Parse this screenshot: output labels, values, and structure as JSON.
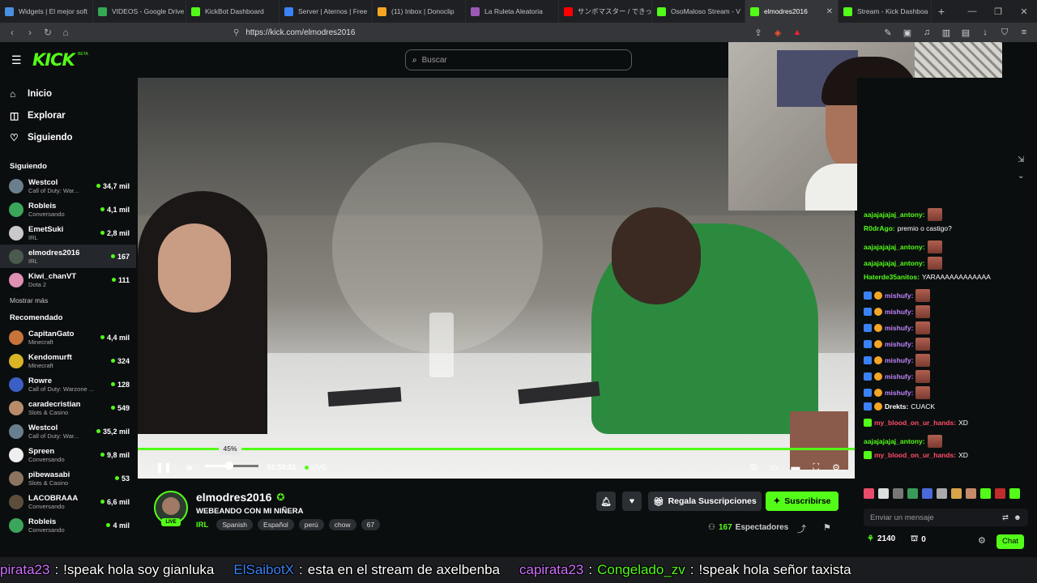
{
  "browser": {
    "tabs": [
      {
        "label": "Widgets | El mejor soft",
        "fav_color": "#4a90e2",
        "icon": "widget-icon"
      },
      {
        "label": "VIDEOS - Google Drive",
        "fav_color": "#34a853",
        "icon": "drive-icon"
      },
      {
        "label": "KickBot Dashboard",
        "fav_color": "#53fc18",
        "icon": "kick-icon"
      },
      {
        "label": "Server | Aternos | Free",
        "fav_color": "#3b82f6",
        "icon": "aternos-icon"
      },
      {
        "label": "(11) Inbox | Donoclip",
        "fav_color": "#f5a623",
        "icon": "donoclip-icon"
      },
      {
        "label": "La Ruleta Aleatoria",
        "fav_color": "#9b59b6",
        "icon": "ruleta-icon"
      },
      {
        "label": "サンボマスター / できっこな",
        "fav_color": "#ff0000",
        "icon": "youtube-icon"
      },
      {
        "label": "OsoMaloso Stream - V",
        "fav_color": "#53fc18",
        "icon": "kick-icon"
      },
      {
        "label": "elmodres2016",
        "fav_color": "#53fc18",
        "icon": "kick-icon",
        "active": true
      },
      {
        "label": "Stream - Kick Dashboa",
        "fav_color": "#53fc18",
        "icon": "kick-icon"
      }
    ],
    "url": "https://kick.com/elmodres2016"
  },
  "header": {
    "logo": "KICK",
    "beta": "BETA",
    "search_placeholder": "Buscar"
  },
  "sidebar": {
    "nav": [
      {
        "label": "Inicio",
        "icon": "home-icon"
      },
      {
        "label": "Explorar",
        "icon": "compass-icon"
      },
      {
        "label": "Siguiendo",
        "icon": "heart-icon"
      }
    ],
    "following_title": "Siguiendo",
    "following": [
      {
        "name": "Westcol",
        "game": "Call of Duty: War...",
        "viewers": "34,7 mil",
        "color": "#6a7f8e"
      },
      {
        "name": "Robleis",
        "game": "Conversando",
        "viewers": "4,1 mil",
        "color": "#3ba55c"
      },
      {
        "name": "EmetSuki",
        "game": "IRL",
        "viewers": "2,8 mil",
        "color": "#c9c9c9"
      },
      {
        "name": "elmodres2016",
        "game": "IRL",
        "viewers": "167",
        "color": "#4a5a4e",
        "selected": true
      },
      {
        "name": "Kiwi_chanVT",
        "game": "Dota 2",
        "viewers": "111",
        "color": "#e08fb5"
      }
    ],
    "show_more": "Mostrar más",
    "recommended_title": "Recomendado",
    "recommended": [
      {
        "name": "CapitanGato",
        "game": "Minecraft",
        "viewers": "4,4 mil",
        "color": "#c7733a"
      },
      {
        "name": "Kendomurft",
        "game": "Minecraft",
        "viewers": "324",
        "color": "#d9b526"
      },
      {
        "name": "Rowre",
        "game": "Call of Duty: Warzone ...",
        "viewers": "128",
        "color": "#3b5fc4"
      },
      {
        "name": "caradecristian",
        "game": "Slots & Casino",
        "viewers": "549",
        "color": "#b88c6a"
      },
      {
        "name": "Westcol",
        "game": "Call of Duty: War...",
        "viewers": "35,2 mil",
        "color": "#6a7f8e"
      },
      {
        "name": "Spreen",
        "game": "Conversando",
        "viewers": "9,8 mil",
        "color": "#eeeeee"
      },
      {
        "name": "pibewasabi",
        "game": "Slots & Casino",
        "viewers": "53",
        "color": "#8c7460"
      },
      {
        "name": "LACOBRAAA",
        "game": "Conversando",
        "viewers": "6,6 mil",
        "color": "#5d4e3c"
      },
      {
        "name": "Robleis",
        "game": "Conversando",
        "viewers": "4 mil",
        "color": "#3ba55c"
      }
    ]
  },
  "player": {
    "volume_percent": 45,
    "volume_label": "45%",
    "time": "01:53:51",
    "live": "LIVE"
  },
  "stream": {
    "channel": "elmodres2016",
    "title": "WEBEANDO CON MI NIÑERA",
    "category": "IRL",
    "tags": [
      "Spanish",
      "Español",
      "perú",
      "chow",
      "67"
    ],
    "live_badge": "LIVE",
    "gift_label": "Regala Suscripciones",
    "subscribe_label": "Suscribirse",
    "viewers": "167",
    "viewers_label": "Espectadores"
  },
  "chat": {
    "messages": [
      {
        "user": "aajajajajaj_antony:",
        "text": "",
        "emote": true,
        "color": "#53fc18"
      },
      {
        "user": "R0drAgo:",
        "text": "premio o castigo?",
        "emote": false,
        "color": "#53fc18"
      },
      {
        "user": "aajajajajaj_antony:",
        "text": "",
        "emote": true,
        "color": "#53fc18"
      },
      {
        "user": "aajajajajaj_antony:",
        "text": "",
        "emote": true,
        "color": "#53fc18"
      },
      {
        "user": "Haterde35anitos:",
        "text": "YARAAAAAAAAAAAA",
        "emote": false,
        "color": "#53fc18"
      },
      {
        "user": "mishufy:",
        "text": "",
        "emote": true,
        "color": "#c084fc",
        "badges": true
      },
      {
        "user": "mishufy:",
        "text": "",
        "emote": true,
        "color": "#c084fc",
        "badges": true
      },
      {
        "user": "mishufy:",
        "text": "",
        "emote": true,
        "color": "#c084fc",
        "badges": true
      },
      {
        "user": "mishufy:",
        "text": "",
        "emote": true,
        "color": "#c084fc",
        "badges": true
      },
      {
        "user": "mishufy:",
        "text": "",
        "emote": true,
        "color": "#c084fc",
        "badges": true
      },
      {
        "user": "mishufy:",
        "text": "",
        "emote": true,
        "color": "#c084fc",
        "badges": true
      },
      {
        "user": "mishufy:",
        "text": "",
        "emote": true,
        "color": "#c084fc",
        "badges": true
      },
      {
        "user": "Drekts:",
        "text": "CUACK",
        "emote": false,
        "color": "#ffffff",
        "badges": true
      },
      {
        "user": "my_blood_on_ur_hands:",
        "text": "XD",
        "emote": false,
        "color": "#ff4d6a",
        "gift": true
      },
      {
        "user": "aajajajajaj_antony:",
        "text": "",
        "emote": true,
        "color": "#53fc18"
      },
      {
        "user": "my_blood_on_ur_hands:",
        "text": "XD",
        "emote": false,
        "color": "#ff4d6a",
        "gift": true
      }
    ],
    "input_placeholder": "Enviar un mensaje",
    "points": "2140",
    "points2": "0",
    "chat_button": "Chat"
  },
  "ticker": [
    {
      "user": "pirata23",
      "sep": " : ",
      "text": "!speak hola soy gianluka",
      "color": "#cf6fff"
    },
    {
      "user": "ElSaibotX",
      "sep": " : ",
      "text": "esta en el stream de axelbenba",
      "color": "#3b82f6"
    },
    {
      "user": "capirata23",
      "sep": " : ",
      "text": "",
      "color": "#cf6fff"
    },
    {
      "user": "Congelado_zv",
      "sep": " : ",
      "text": "!speak hola señor taxista",
      "color": "#53fc18"
    }
  ]
}
